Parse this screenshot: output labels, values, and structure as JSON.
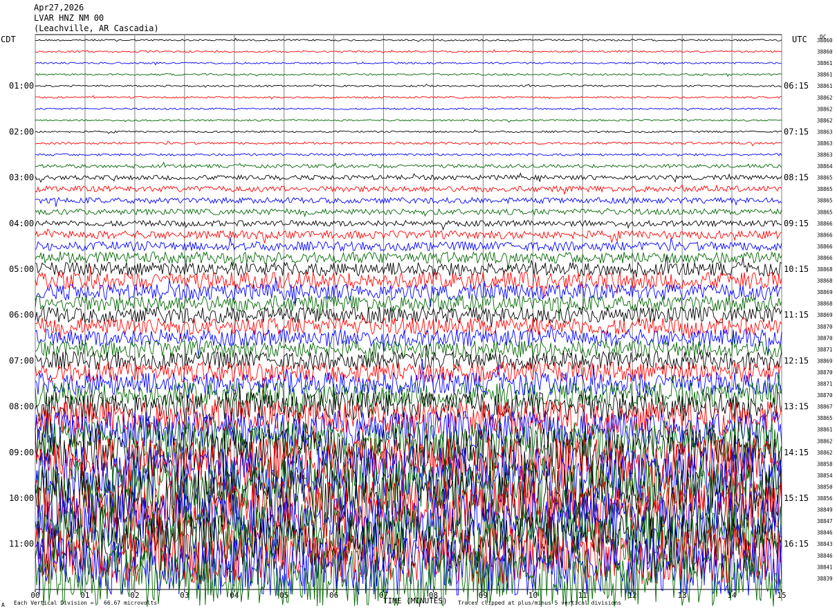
{
  "header": {
    "date": "Apr27,2026",
    "station": "LVAR HNZ NM 00",
    "location": "(Leachville, AR Cascadia)"
  },
  "left_timezone": "CDT",
  "right_timezone": "UTC",
  "dc_label": "DC",
  "footer": {
    "scale_note": "Each Vertical Division =   66.67 microvolts",
    "xlabel": "TIME (MINUTES)",
    "clip_note": "Traces clipped at plus/minus 5 vertical divisions",
    "corner_mark": "A"
  },
  "colors": {
    "trace_cycle": [
      "#000000",
      "#ff0000",
      "#0000ff",
      "#006600"
    ],
    "grid": "#808080"
  },
  "chart_data": {
    "type": "line",
    "title": "LVAR HNZ NM 00",
    "xlabel": "TIME (MINUTES)",
    "xlim": [
      0,
      15
    ],
    "x_ticks": [
      "00",
      "01",
      "02",
      "03",
      "04",
      "05",
      "06",
      "07",
      "08",
      "09",
      "10",
      "11",
      "12",
      "13",
      "14",
      "15"
    ],
    "traces_per_hour": 4,
    "minutes_per_trace": 15,
    "left_hour_labels": [
      "01:00",
      "02:00",
      "03:00",
      "04:00",
      "05:00",
      "06:00",
      "07:00",
      "08:00",
      "09:00",
      "10:00",
      "11:00"
    ],
    "right_hour_labels": [
      "06:15",
      "07:15",
      "08:15",
      "09:15",
      "10:15",
      "11:15",
      "12:15",
      "13:15",
      "14:15",
      "15:15",
      "16:15"
    ],
    "dc_offsets": [
      38860,
      38860,
      38861,
      38861,
      38861,
      38862,
      38862,
      38862,
      38863,
      38863,
      38863,
      38864,
      38865,
      38865,
      38865,
      38865,
      38866,
      38866,
      38866,
      38866,
      38868,
      38868,
      38869,
      38868,
      38869,
      38870,
      38870,
      38871,
      38869,
      38870,
      38871,
      38870,
      38867,
      38865,
      38861,
      38862,
      38862,
      38858,
      38854,
      38850,
      38856,
      38849,
      38847,
      38846,
      38843,
      38846,
      38841,
      38839
    ],
    "amplitude_divisions": [
      0.15,
      0.15,
      0.15,
      0.15,
      0.15,
      0.15,
      0.15,
      0.15,
      0.15,
      0.2,
      0.2,
      0.3,
      0.4,
      0.5,
      0.5,
      0.5,
      0.5,
      0.7,
      0.8,
      1.0,
      1.2,
      1.5,
      1.4,
      1.4,
      1.4,
      1.5,
      1.5,
      1.5,
      1.6,
      1.8,
      2.0,
      2.2,
      2.6,
      3.0,
      3.2,
      3.6,
      4.2,
      4.5,
      5.0,
      5.0,
      5.0,
      5.0,
      5.0,
      5.0,
      5.0,
      5.0,
      5.0,
      5.0
    ],
    "clip_divisions": 5
  }
}
